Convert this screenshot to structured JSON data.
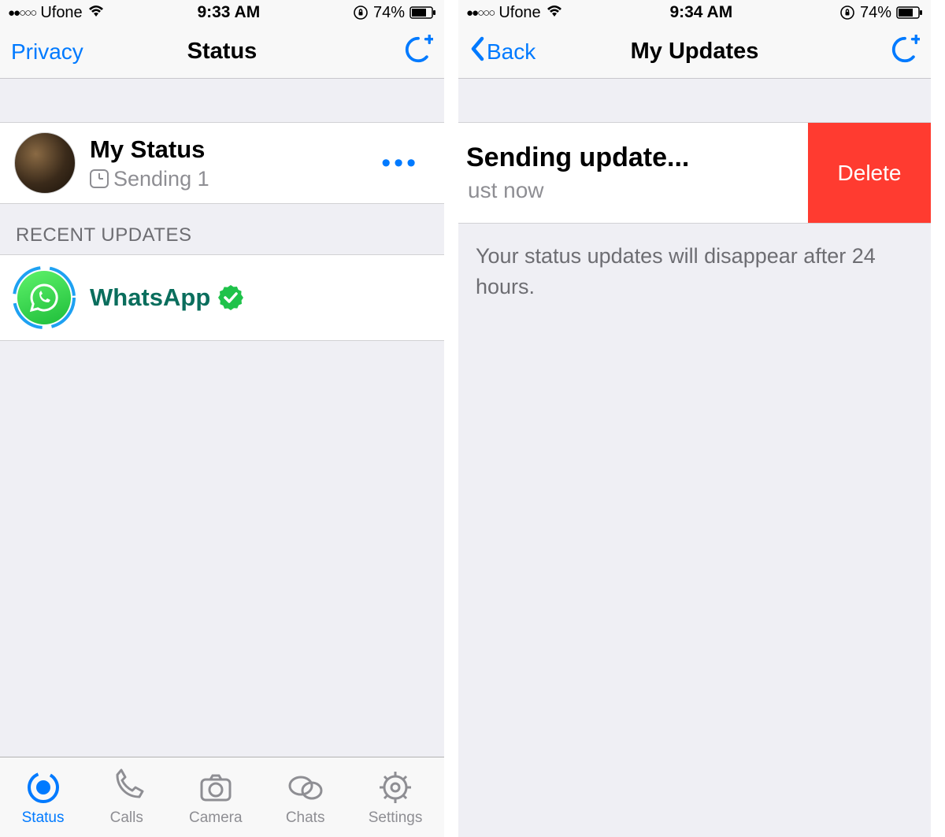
{
  "left": {
    "status_bar": {
      "carrier": "Ufone",
      "time": "9:33 AM",
      "battery": "74%"
    },
    "nav": {
      "left": "Privacy",
      "title": "Status"
    },
    "my_status": {
      "title": "My Status",
      "sub": "Sending 1"
    },
    "section_header": "RECENT UPDATES",
    "recent": {
      "name": "WhatsApp"
    },
    "tabs": {
      "status": "Status",
      "calls": "Calls",
      "camera": "Camera",
      "chats": "Chats",
      "settings": "Settings"
    }
  },
  "right": {
    "status_bar": {
      "carrier": "Ufone",
      "time": "9:34 AM",
      "battery": "74%"
    },
    "nav": {
      "back": "Back",
      "title": "My Updates"
    },
    "row": {
      "title": "Sending update...",
      "sub": "ust now",
      "delete": "Delete"
    },
    "info": "Your status updates will disappear after 24 hours."
  },
  "signal_dots": "●●○○○"
}
